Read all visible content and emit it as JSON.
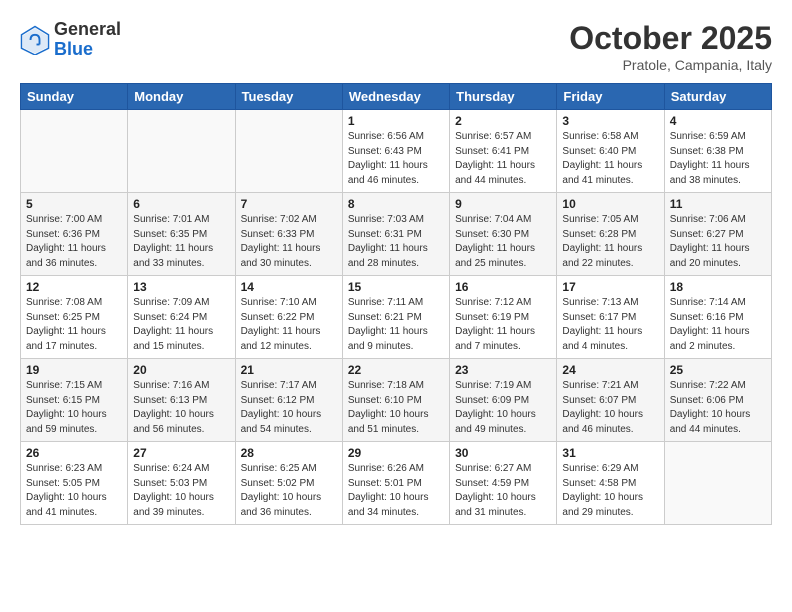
{
  "header": {
    "logo_general": "General",
    "logo_blue": "Blue",
    "month_title": "October 2025",
    "location": "Pratole, Campania, Italy"
  },
  "days_of_week": [
    "Sunday",
    "Monday",
    "Tuesday",
    "Wednesday",
    "Thursday",
    "Friday",
    "Saturday"
  ],
  "weeks": [
    [
      {
        "day": "",
        "info": ""
      },
      {
        "day": "",
        "info": ""
      },
      {
        "day": "",
        "info": ""
      },
      {
        "day": "1",
        "info": "Sunrise: 6:56 AM\nSunset: 6:43 PM\nDaylight: 11 hours and 46 minutes."
      },
      {
        "day": "2",
        "info": "Sunrise: 6:57 AM\nSunset: 6:41 PM\nDaylight: 11 hours and 44 minutes."
      },
      {
        "day": "3",
        "info": "Sunrise: 6:58 AM\nSunset: 6:40 PM\nDaylight: 11 hours and 41 minutes."
      },
      {
        "day": "4",
        "info": "Sunrise: 6:59 AM\nSunset: 6:38 PM\nDaylight: 11 hours and 38 minutes."
      }
    ],
    [
      {
        "day": "5",
        "info": "Sunrise: 7:00 AM\nSunset: 6:36 PM\nDaylight: 11 hours and 36 minutes."
      },
      {
        "day": "6",
        "info": "Sunrise: 7:01 AM\nSunset: 6:35 PM\nDaylight: 11 hours and 33 minutes."
      },
      {
        "day": "7",
        "info": "Sunrise: 7:02 AM\nSunset: 6:33 PM\nDaylight: 11 hours and 30 minutes."
      },
      {
        "day": "8",
        "info": "Sunrise: 7:03 AM\nSunset: 6:31 PM\nDaylight: 11 hours and 28 minutes."
      },
      {
        "day": "9",
        "info": "Sunrise: 7:04 AM\nSunset: 6:30 PM\nDaylight: 11 hours and 25 minutes."
      },
      {
        "day": "10",
        "info": "Sunrise: 7:05 AM\nSunset: 6:28 PM\nDaylight: 11 hours and 22 minutes."
      },
      {
        "day": "11",
        "info": "Sunrise: 7:06 AM\nSunset: 6:27 PM\nDaylight: 11 hours and 20 minutes."
      }
    ],
    [
      {
        "day": "12",
        "info": "Sunrise: 7:08 AM\nSunset: 6:25 PM\nDaylight: 11 hours and 17 minutes."
      },
      {
        "day": "13",
        "info": "Sunrise: 7:09 AM\nSunset: 6:24 PM\nDaylight: 11 hours and 15 minutes."
      },
      {
        "day": "14",
        "info": "Sunrise: 7:10 AM\nSunset: 6:22 PM\nDaylight: 11 hours and 12 minutes."
      },
      {
        "day": "15",
        "info": "Sunrise: 7:11 AM\nSunset: 6:21 PM\nDaylight: 11 hours and 9 minutes."
      },
      {
        "day": "16",
        "info": "Sunrise: 7:12 AM\nSunset: 6:19 PM\nDaylight: 11 hours and 7 minutes."
      },
      {
        "day": "17",
        "info": "Sunrise: 7:13 AM\nSunset: 6:17 PM\nDaylight: 11 hours and 4 minutes."
      },
      {
        "day": "18",
        "info": "Sunrise: 7:14 AM\nSunset: 6:16 PM\nDaylight: 11 hours and 2 minutes."
      }
    ],
    [
      {
        "day": "19",
        "info": "Sunrise: 7:15 AM\nSunset: 6:15 PM\nDaylight: 10 hours and 59 minutes."
      },
      {
        "day": "20",
        "info": "Sunrise: 7:16 AM\nSunset: 6:13 PM\nDaylight: 10 hours and 56 minutes."
      },
      {
        "day": "21",
        "info": "Sunrise: 7:17 AM\nSunset: 6:12 PM\nDaylight: 10 hours and 54 minutes."
      },
      {
        "day": "22",
        "info": "Sunrise: 7:18 AM\nSunset: 6:10 PM\nDaylight: 10 hours and 51 minutes."
      },
      {
        "day": "23",
        "info": "Sunrise: 7:19 AM\nSunset: 6:09 PM\nDaylight: 10 hours and 49 minutes."
      },
      {
        "day": "24",
        "info": "Sunrise: 7:21 AM\nSunset: 6:07 PM\nDaylight: 10 hours and 46 minutes."
      },
      {
        "day": "25",
        "info": "Sunrise: 7:22 AM\nSunset: 6:06 PM\nDaylight: 10 hours and 44 minutes."
      }
    ],
    [
      {
        "day": "26",
        "info": "Sunrise: 6:23 AM\nSunset: 5:05 PM\nDaylight: 10 hours and 41 minutes."
      },
      {
        "day": "27",
        "info": "Sunrise: 6:24 AM\nSunset: 5:03 PM\nDaylight: 10 hours and 39 minutes."
      },
      {
        "day": "28",
        "info": "Sunrise: 6:25 AM\nSunset: 5:02 PM\nDaylight: 10 hours and 36 minutes."
      },
      {
        "day": "29",
        "info": "Sunrise: 6:26 AM\nSunset: 5:01 PM\nDaylight: 10 hours and 34 minutes."
      },
      {
        "day": "30",
        "info": "Sunrise: 6:27 AM\nSunset: 4:59 PM\nDaylight: 10 hours and 31 minutes."
      },
      {
        "day": "31",
        "info": "Sunrise: 6:29 AM\nSunset: 4:58 PM\nDaylight: 10 hours and 29 minutes."
      },
      {
        "day": "",
        "info": ""
      }
    ]
  ]
}
